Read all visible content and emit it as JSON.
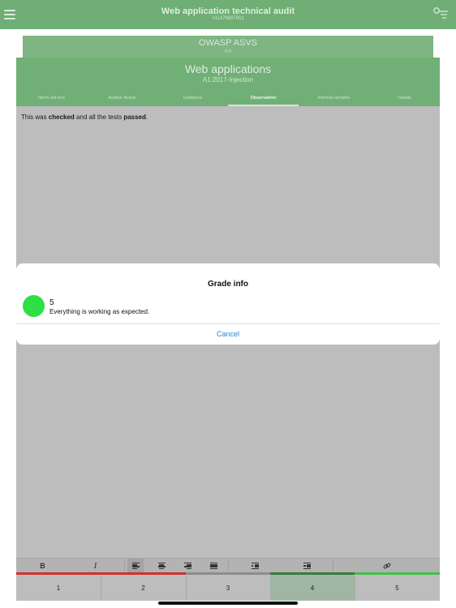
{
  "app": {
    "title": "Web application technical audit",
    "subtitle": "#11476897001"
  },
  "back_card": {
    "title": "OWASP ASVS",
    "subtitle": "4.0"
  },
  "card": {
    "title": "Web applications",
    "subtitle": "A1:2017-Injection",
    "tabs": [
      {
        "label": "Norm std text"
      },
      {
        "label": "Auditor Action"
      },
      {
        "label": "Guidance"
      },
      {
        "label": "Observation"
      },
      {
        "label": "Internal remarks"
      },
      {
        "label": "Details"
      }
    ],
    "active_tab": "Observation"
  },
  "observation": {
    "t1": "This was ",
    "b1": "checked",
    "t2": " and all the tests ",
    "b2": "passed",
    "t3": "."
  },
  "toolbar": {
    "bold": "B",
    "italic": "I",
    "icons": [
      "align-left-icon",
      "align-center-icon",
      "align-right-icon",
      "align-justify-icon",
      "outdent-icon",
      "indent-icon",
      "link-icon"
    ]
  },
  "grades": {
    "items": [
      {
        "label": "1",
        "color": "#d32f2f"
      },
      {
        "label": "2",
        "color": "#d32f2f"
      },
      {
        "label": "3",
        "color": "#8d8d8d"
      },
      {
        "label": "4",
        "color": "#3b7a40"
      },
      {
        "label": "5",
        "color": "#43c049"
      }
    ],
    "selected": "4"
  },
  "dialog": {
    "title": "Grade info",
    "grade": "5",
    "description": "Everything is working as expected.",
    "circle_color": "#2ee044",
    "cancel_label": "Cancel"
  }
}
